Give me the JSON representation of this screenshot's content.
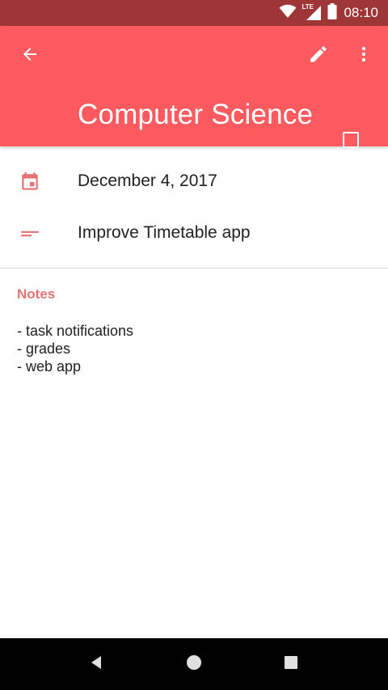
{
  "status_bar": {
    "time": "08:10",
    "icons": [
      "wifi-icon",
      "lte-signal-icon",
      "battery-icon"
    ],
    "network_label": "LTE"
  },
  "app_bar": {
    "title": "Computer Science",
    "icons": [
      "back-arrow-icon",
      "edit-pencil-icon",
      "more-vert-icon"
    ],
    "completed_checked": false
  },
  "details": {
    "date": "December 4, 2017",
    "date_icon": "calendar-icon",
    "description": "Improve Timetable app",
    "description_icon": "short-text-icon"
  },
  "notes": {
    "label": "Notes",
    "lines": [
      "- task notifications",
      "- grades",
      "- web app"
    ]
  },
  "nav_bar": {
    "icons": [
      "nav-back-icon",
      "nav-home-icon",
      "nav-recents-icon"
    ]
  },
  "colors": {
    "app_bar": "#ff5a5f",
    "status_bar": "#9e3536",
    "accent": "#e57373"
  }
}
